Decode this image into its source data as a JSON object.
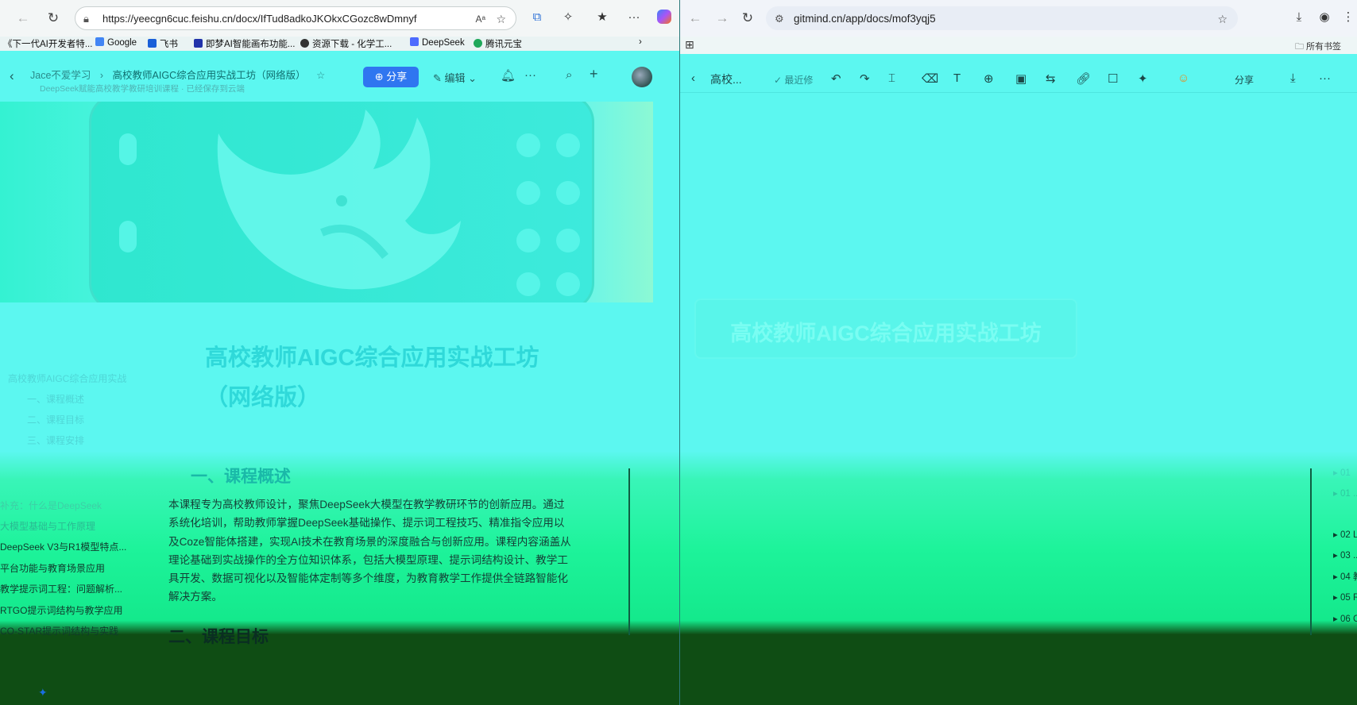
{
  "left_browser": {
    "url": "https://yeecgn6cuc.feishu.cn/docx/IfTud8adkoJKOkxCGozc8wDmnyf",
    "bookmarks": [
      "《下一代AI开发者特...",
      "Google",
      "飞书",
      "即梦AI智能画布功能...",
      "资源下载 - 化学工...",
      "DeepSeek",
      "腾讯元宝"
    ]
  },
  "doc_header": {
    "breadcrumb_root": "Jace不爱学习",
    "breadcrumb_sep": "›",
    "breadcrumb_current": "高校教师AIGC综合应用实战工坊（网络版）",
    "subline": "DeepSeek赋能高校教学教研培训课程 · 已经保存到云端",
    "share_label": "分享",
    "edit_label": "编辑"
  },
  "doc": {
    "title_line1": "高校教师AIGC综合应用实战工坊",
    "title_line2": "（网络版）",
    "section1_heading": "一、课程概述",
    "section1_body": "本课程专为高校教师设计，聚焦DeepSeek大模型在教学教研环节的创新应用。通过系统化培训，帮助教师掌握DeepSeek基础操作、提示词工程技巧、精准指令应用以及Coze智能体搭建，实现AI技术在教育场景的深度融合与创新应用。课程内容涵盖从理论基础到实战操作的全方位知识体系，包括大模型原理、提示词结构设计、教学工具开发、数据可视化以及智能体定制等多个维度，为教育教学工作提供全链路智能化解决方案。",
    "section2_heading": "二、课程目标"
  },
  "outline": {
    "items": [
      "高校教师AIGC综合应用实战",
      "一、课程概述",
      "二、课程目标",
      "三、课程安排",
      "补充：什么是DeepSeek",
      "大模型基础与工作原理",
      "DeepSeek V3与R1模型特点...",
      "平台功能与教育场景应用",
      "教学提示词工程：问题解析...",
      "RTGO提示词结构与教学应用",
      "CO-STAR提示词结构与实践"
    ]
  },
  "right_browser": {
    "url": "gitmind.cn/app/docs/mof3yqj5",
    "all_bookmarks": "所有书签"
  },
  "gitmind": {
    "doc_name": "高校...",
    "recent_label": "最近修",
    "share_label": "分享",
    "root_node": "高校教师AIGC综合应用实战工坊",
    "branches": [
      "▸ 01",
      "▸ 01 ...",
      "▸ 02 L",
      "▸ 03 ...",
      "▸ 04 教",
      "▸ 05 R",
      "▸ 06 C"
    ]
  },
  "colors": {
    "share_button": "#2f76f0",
    "wash_top": "#5cf7f0",
    "wash_bottom": "#0f4d14"
  }
}
